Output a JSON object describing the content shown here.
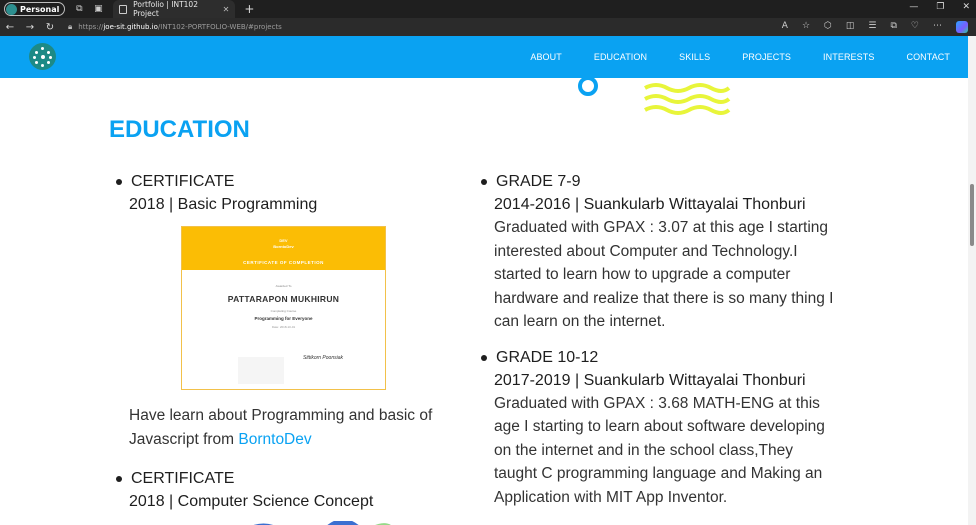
{
  "browser": {
    "profile_label": "Personal",
    "tab_title": "Portfolio | INT102 Project",
    "url_prefix": "https://",
    "url_host": "joe-sit.github.io",
    "url_path": "/INT102-PORTFOLIO-WEB/#projects"
  },
  "nav": {
    "items": [
      "ABOUT",
      "EDUCATION",
      "SKILLS",
      "PROJECTS",
      "INTERESTS",
      "CONTACT"
    ]
  },
  "section": {
    "title": "EDUCATION"
  },
  "left": {
    "item1": {
      "heading": "CERTIFICATE",
      "sub": "2018 | Basic Programming",
      "desc_before": "Have learn about Programming and basic of Javascript from ",
      "link": "BorntoDev"
    },
    "cert": {
      "brand": "DEV",
      "org": "BorntoDev",
      "title": "CERTIFICATE OF COMPLETION",
      "presented": "Awarded To",
      "name": "PATTARAPON MUKHIRUN",
      "completing": "Completing Course",
      "course": "Programming for Everyone",
      "date": "Date: 2018-10-01",
      "signature": "Sittikorn Poonsiak"
    },
    "item2": {
      "heading": "CERTIFICATE",
      "sub": "2018 | Computer Science Concept"
    }
  },
  "right": {
    "item1": {
      "heading": "GRADE 7-9",
      "sub": "2014-2016 | Suankularb Wittayalai Thonburi",
      "desc": "Graduated with GPAX : 3.07 at this age I starting interested about Computer and Technology.I started to learn how to upgrade a computer hardware and realize that there is so many thing I can learn on the internet."
    },
    "item2": {
      "heading": "GRADE 10-12",
      "sub": "2017-2019 | Suankularb Wittayalai Thonburi",
      "desc": "Graduated with GPAX : 3.68 MATH-ENG at this age I starting to learn about software developing on the internet and in the school class,They taught C programming language and Making an Application with MIT App Inventor."
    }
  },
  "colors": {
    "accent": "#0aa2f2",
    "logo_bg": "#1d8a86",
    "wave": "#e8f53a",
    "cert_header": "#fbbd05"
  }
}
